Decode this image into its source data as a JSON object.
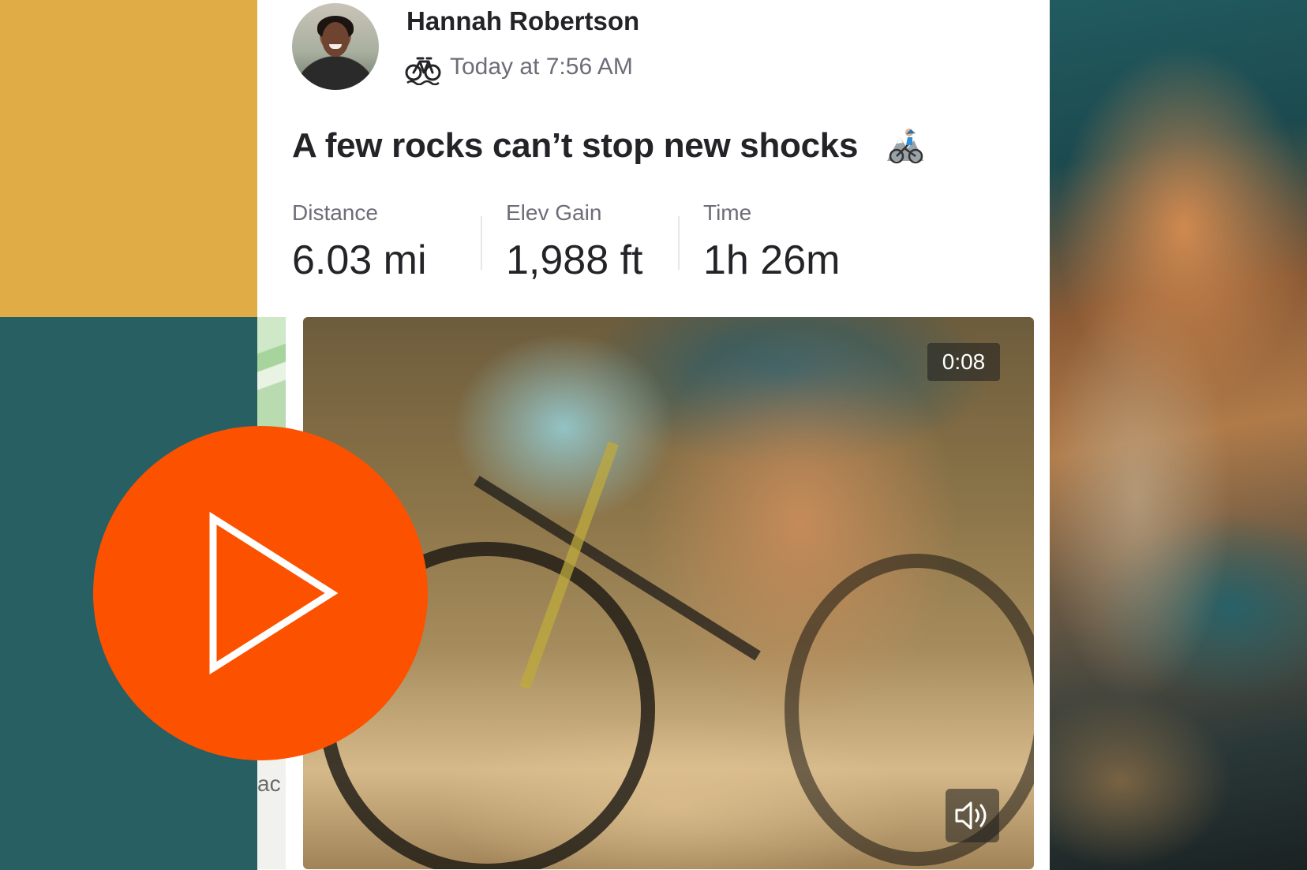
{
  "activity": {
    "athlete_name": "Hannah Robertson",
    "timestamp": "Today at 7:56 AM",
    "sport_icon": "bike-icon",
    "title": "A few rocks can’t stop new shocks",
    "title_emoji": "mountain-biker-emoji",
    "stats": [
      {
        "label": "Distance",
        "value": "6.03 mi"
      },
      {
        "label": "Elev Gain",
        "value": "1,988 ft"
      },
      {
        "label": "Time",
        "value": "1h 26m"
      }
    ]
  },
  "map": {
    "partial_label": "ac"
  },
  "video": {
    "duration": "0:08",
    "sound_icon": "speaker-icon"
  },
  "overlay": {
    "play_icon": "play-icon"
  },
  "colors": {
    "brand_orange": "#fc5200",
    "mustard": "#e0ac45",
    "teal": "#275f63",
    "text_primary": "#242428",
    "text_secondary": "#6d6d78"
  }
}
